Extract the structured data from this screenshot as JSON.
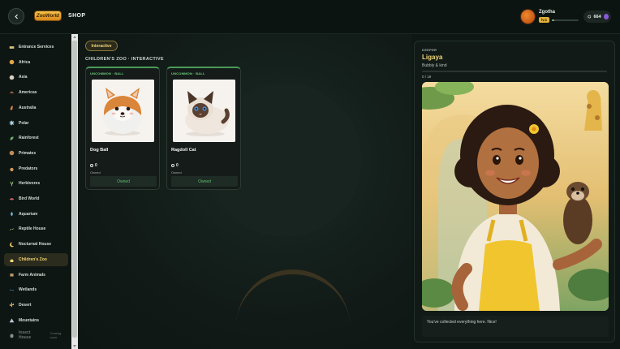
{
  "header": {
    "logo_text": "ZooWorld",
    "title": "SHOP",
    "user": {
      "name": "Zgotha",
      "level": "lv.1",
      "xp_fraction": 0.1
    },
    "currency": {
      "amount": "664"
    }
  },
  "sidebar": {
    "items": [
      {
        "label": "Entrance Services",
        "icon": "ticket-icon"
      },
      {
        "label": "Africa",
        "icon": "lion-icon"
      },
      {
        "label": "Asia",
        "icon": "panda-icon"
      },
      {
        "label": "Americas",
        "icon": "eagle-icon"
      },
      {
        "label": "Australia",
        "icon": "kangaroo-icon"
      },
      {
        "label": "Polar",
        "icon": "snowflake-icon"
      },
      {
        "label": "Rainforest",
        "icon": "leaf-icon"
      },
      {
        "label": "Primates",
        "icon": "monkey-icon"
      },
      {
        "label": "Predators",
        "icon": "paw-icon"
      },
      {
        "label": "Herbivores",
        "icon": "deer-icon"
      },
      {
        "label": "Bird World",
        "icon": "bird-icon"
      },
      {
        "label": "Aquarium",
        "icon": "drop-icon"
      },
      {
        "label": "Reptile House",
        "icon": "snake-icon"
      },
      {
        "label": "Nocturnal House",
        "icon": "moon-icon"
      },
      {
        "label": "Children's Zoo",
        "icon": "bunny-icon",
        "active": true
      },
      {
        "label": "Farm Animals",
        "icon": "cow-icon"
      },
      {
        "label": "Wetlands",
        "icon": "wave-icon"
      },
      {
        "label": "Desert",
        "icon": "cactus-icon"
      },
      {
        "label": "Mountains",
        "icon": "mountain-icon"
      },
      {
        "label": "Insect House",
        "icon": "bug-icon",
        "badge": "Coming soon",
        "disabled": true
      }
    ]
  },
  "main": {
    "filter_label": "Interactive",
    "section_title": "CHILDREN'S ZOO · INTERACTIVE",
    "cards": [
      {
        "rarity": "UNCOMMON · BALL",
        "name": "Dog Ball",
        "price": "0",
        "status": "Owned",
        "button": "Owned"
      },
      {
        "rarity": "UNCOMMON · BALL",
        "name": "Ragdoll Cat",
        "price": "0",
        "status": "Owned",
        "button": "Owned"
      }
    ]
  },
  "keeper": {
    "label": "KEEPER",
    "name": "Ligaya",
    "trait": "Bubbly & kind",
    "progress": "0 / 19",
    "message": "You've collected everything here. Nice!"
  },
  "colors": {
    "accent_gold": "#f1d777",
    "rarity_green": "#6fcf7c",
    "background": "#0f1714"
  }
}
